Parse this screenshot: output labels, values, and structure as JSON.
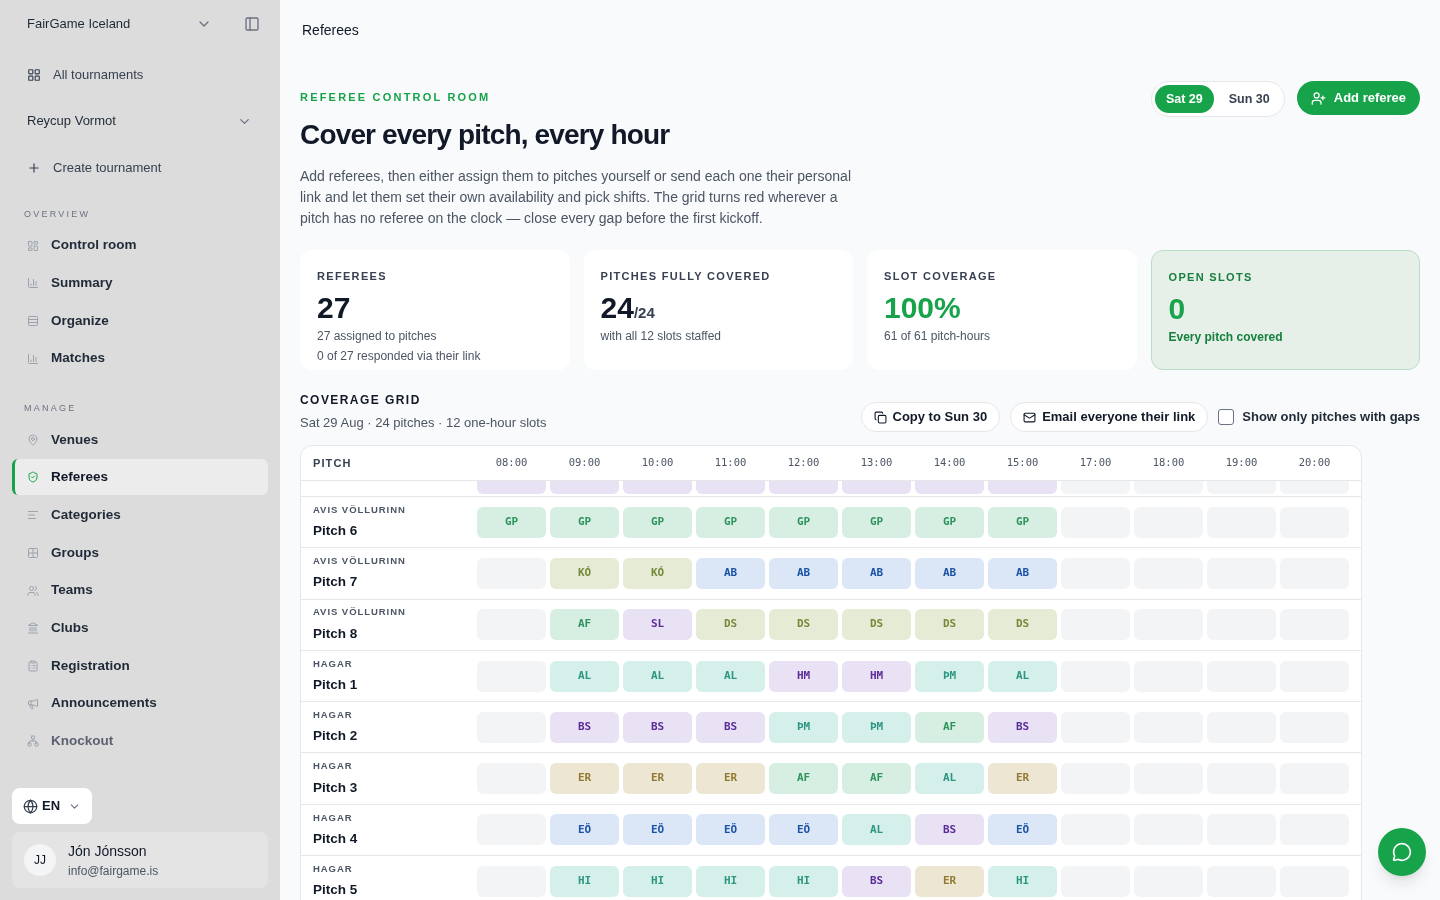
{
  "sidebar": {
    "org": "FairGame Iceland",
    "all_tournaments": "All tournaments",
    "tournament": "Reycup Vormot",
    "create": "Create tournament",
    "sections": [
      {
        "title": "OVERVIEW",
        "items": [
          {
            "label": "Control room",
            "selected": false,
            "disabled": false
          },
          {
            "label": "Summary",
            "selected": false,
            "disabled": false
          },
          {
            "label": "Organize",
            "selected": false,
            "disabled": false
          },
          {
            "label": "Matches",
            "selected": false,
            "disabled": false
          }
        ]
      },
      {
        "title": "MANAGE",
        "items": [
          {
            "label": "Venues",
            "selected": false,
            "disabled": false
          },
          {
            "label": "Referees",
            "selected": true,
            "disabled": false
          },
          {
            "label": "Categories",
            "selected": false,
            "disabled": false
          },
          {
            "label": "Groups",
            "selected": false,
            "disabled": false
          },
          {
            "label": "Teams",
            "selected": false,
            "disabled": false
          },
          {
            "label": "Clubs",
            "selected": false,
            "disabled": false
          },
          {
            "label": "Registration",
            "selected": false,
            "disabled": false
          },
          {
            "label": "Announcements",
            "selected": false,
            "disabled": false
          },
          {
            "label": "Knockout",
            "selected": false,
            "disabled": true
          }
        ]
      }
    ],
    "language": "EN",
    "user": {
      "initials": "JJ",
      "name": "Jón Jónsson",
      "email": "info@fairgame.is"
    }
  },
  "page_title": "Referees",
  "eyebrow": "REFEREE CONTROL ROOM",
  "heading": "Cover every pitch, every hour",
  "intro": "Add referees, then either assign them to pitches yourself or send each one their personal link and let them set their own availability and pick shifts. The grid turns red wherever a pitch has no referee on the clock — close every gap before the first kickoff.",
  "days": [
    {
      "label": "Sat 29",
      "selected": true
    },
    {
      "label": "Sun 30",
      "selected": false
    }
  ],
  "add_button": "Add referee",
  "stats": [
    {
      "label": "REFEREES",
      "value": "27",
      "positive": false,
      "highlight": false,
      "lines": [
        "27 assigned to pitches",
        "0 of 27 responded via their link"
      ]
    },
    {
      "label": "PITCHES FULLY COVERED",
      "value": "24",
      "suffix": "/24",
      "positive": false,
      "highlight": false,
      "lines": [
        "with all 12 slots staffed"
      ]
    },
    {
      "label": "SLOT COVERAGE",
      "value": "100%",
      "positive": true,
      "highlight": false,
      "lines": [
        "61 of 61 pitch-hours"
      ]
    },
    {
      "label": "OPEN SLOTS",
      "value": "0",
      "positive": true,
      "highlight": true,
      "lines": [
        "Every pitch covered"
      ]
    }
  ],
  "grid": {
    "title": "COVERAGE GRID",
    "subtitle": "Sat 29 Aug · 24 pitches · 12 one-hour slots",
    "copy_button": "Copy to Sun 30",
    "email_button": "Email everyone their link",
    "filter": {
      "label": "Show only pitches with gaps",
      "checked": false
    },
    "columns": [
      "PITCH",
      "08:00",
      "09:00",
      "10:00",
      "11:00",
      "12:00",
      "13:00",
      "14:00",
      "15:00",
      "17:00",
      "18:00",
      "19:00",
      "20:00"
    ],
    "partial_row": [
      {
        "color": "#e9e1f4"
      },
      {
        "color": "#e9e1f4"
      },
      {
        "color": "#e9e1f4"
      },
      {
        "color": "#e9e1f4"
      },
      {
        "color": "#e9e1f4"
      },
      {
        "color": "#e9e1f4"
      },
      {
        "color": "#e9e1f4"
      },
      {
        "color": "#e9e1f4"
      }
    ],
    "rows": [
      {
        "venue": "AVIS VÖLLURINN",
        "pitch": "Pitch 6",
        "slots": [
          {
            "filled": true,
            "code": "GP",
            "color": "#d7efe2"
          },
          {
            "filled": true,
            "code": "GP",
            "color": "#d7efe2"
          },
          {
            "filled": true,
            "code": "GP",
            "color": "#d7efe2"
          },
          {
            "filled": true,
            "code": "GP",
            "color": "#d7efe2"
          },
          {
            "filled": true,
            "code": "GP",
            "color": "#d7efe2"
          },
          {
            "filled": true,
            "code": "GP",
            "color": "#d7efe2"
          },
          {
            "filled": true,
            "code": "GP",
            "color": "#d7efe2"
          },
          {
            "filled": true,
            "code": "GP",
            "color": "#d7efe2"
          },
          {
            "filled": false
          },
          {
            "filled": false
          },
          {
            "filled": false
          },
          {
            "filled": false
          }
        ]
      },
      {
        "venue": "AVIS VÖLLURINN",
        "pitch": "Pitch 7",
        "slots": [
          {
            "filled": false
          },
          {
            "filled": true,
            "code": "KÓ",
            "color": "#e5ebd5"
          },
          {
            "filled": true,
            "code": "KÓ",
            "color": "#e5ebd5"
          },
          {
            "filled": true,
            "code": "AB",
            "color": "#dbe6f6"
          },
          {
            "filled": true,
            "code": "AB",
            "color": "#dbe6f6"
          },
          {
            "filled": true,
            "code": "AB",
            "color": "#dbe6f6"
          },
          {
            "filled": true,
            "code": "AB",
            "color": "#dbe6f6"
          },
          {
            "filled": true,
            "code": "AB",
            "color": "#dbe6f6"
          },
          {
            "filled": false
          },
          {
            "filled": false
          },
          {
            "filled": false
          },
          {
            "filled": false
          }
        ]
      },
      {
        "venue": "AVIS VÖLLURINN",
        "pitch": "Pitch 8",
        "slots": [
          {
            "filled": false
          },
          {
            "filled": true,
            "code": "AF",
            "color": "#d7efe2"
          },
          {
            "filled": true,
            "code": "SL",
            "color": "#e9e1f4"
          },
          {
            "filled": true,
            "code": "DS",
            "color": "#e5ebd5"
          },
          {
            "filled": true,
            "code": "DS",
            "color": "#e5ebd5"
          },
          {
            "filled": true,
            "code": "DS",
            "color": "#e5ebd5"
          },
          {
            "filled": true,
            "code": "DS",
            "color": "#e5ebd5"
          },
          {
            "filled": true,
            "code": "DS",
            "color": "#e5ebd5"
          },
          {
            "filled": false
          },
          {
            "filled": false
          },
          {
            "filled": false
          },
          {
            "filled": false
          }
        ]
      },
      {
        "venue": "HAGAR",
        "pitch": "Pitch 1",
        "slots": [
          {
            "filled": false
          },
          {
            "filled": true,
            "code": "AL",
            "color": "#d5efea"
          },
          {
            "filled": true,
            "code": "AL",
            "color": "#d5efea"
          },
          {
            "filled": true,
            "code": "AL",
            "color": "#d5efea"
          },
          {
            "filled": true,
            "code": "HM",
            "color": "#e9e1f4"
          },
          {
            "filled": true,
            "code": "HM",
            "color": "#e9e1f4"
          },
          {
            "filled": true,
            "code": "ÞM",
            "color": "#d5efea"
          },
          {
            "filled": true,
            "code": "AL",
            "color": "#d5efea"
          },
          {
            "filled": false
          },
          {
            "filled": false
          },
          {
            "filled": false
          },
          {
            "filled": false
          }
        ]
      },
      {
        "venue": "HAGAR",
        "pitch": "Pitch 2",
        "slots": [
          {
            "filled": false
          },
          {
            "filled": true,
            "code": "BS",
            "color": "#e9e1f4"
          },
          {
            "filled": true,
            "code": "BS",
            "color": "#e9e1f4"
          },
          {
            "filled": true,
            "code": "BS",
            "color": "#e9e1f4"
          },
          {
            "filled": true,
            "code": "ÞM",
            "color": "#d5efea"
          },
          {
            "filled": true,
            "code": "ÞM",
            "color": "#d5efea"
          },
          {
            "filled": true,
            "code": "AF",
            "color": "#d7efe2"
          },
          {
            "filled": true,
            "code": "BS",
            "color": "#e9e1f4"
          },
          {
            "filled": false
          },
          {
            "filled": false
          },
          {
            "filled": false
          },
          {
            "filled": false
          }
        ]
      },
      {
        "venue": "HAGAR",
        "pitch": "Pitch 3",
        "slots": [
          {
            "filled": false
          },
          {
            "filled": true,
            "code": "ER",
            "color": "#ece6d2"
          },
          {
            "filled": true,
            "code": "ER",
            "color": "#ece6d2"
          },
          {
            "filled": true,
            "code": "ER",
            "color": "#ece6d2"
          },
          {
            "filled": true,
            "code": "AF",
            "color": "#d7efe2"
          },
          {
            "filled": true,
            "code": "AF",
            "color": "#d7efe2"
          },
          {
            "filled": true,
            "code": "AL",
            "color": "#d5efea"
          },
          {
            "filled": true,
            "code": "ER",
            "color": "#ece6d2"
          },
          {
            "filled": false
          },
          {
            "filled": false
          },
          {
            "filled": false
          },
          {
            "filled": false
          }
        ]
      },
      {
        "venue": "HAGAR",
        "pitch": "Pitch 4",
        "slots": [
          {
            "filled": false
          },
          {
            "filled": true,
            "code": "EÖ",
            "color": "#dbe6f6"
          },
          {
            "filled": true,
            "code": "EÖ",
            "color": "#dbe6f6"
          },
          {
            "filled": true,
            "code": "EÖ",
            "color": "#dbe6f6"
          },
          {
            "filled": true,
            "code": "EÖ",
            "color": "#dbe6f6"
          },
          {
            "filled": true,
            "code": "AL",
            "color": "#d5efea"
          },
          {
            "filled": true,
            "code": "BS",
            "color": "#e9e1f4"
          },
          {
            "filled": true,
            "code": "EÖ",
            "color": "#dbe6f6"
          },
          {
            "filled": false
          },
          {
            "filled": false
          },
          {
            "filled": false
          },
          {
            "filled": false
          }
        ]
      },
      {
        "venue": "HAGAR",
        "pitch": "Pitch 5",
        "slots": [
          {
            "filled": false
          },
          {
            "filled": true,
            "code": "HI",
            "color": "#d5efea"
          },
          {
            "filled": true,
            "code": "HI",
            "color": "#d5efea"
          },
          {
            "filled": true,
            "code": "HI",
            "color": "#d5efea"
          },
          {
            "filled": true,
            "code": "HI",
            "color": "#d5efea"
          },
          {
            "filled": true,
            "code": "BS",
            "color": "#e9e1f4"
          },
          {
            "filled": true,
            "code": "ER",
            "color": "#ece6d2"
          },
          {
            "filled": true,
            "code": "HI",
            "color": "#d5efea"
          },
          {
            "filled": false
          },
          {
            "filled": false
          },
          {
            "filled": false
          },
          {
            "filled": false
          }
        ]
      }
    ]
  }
}
